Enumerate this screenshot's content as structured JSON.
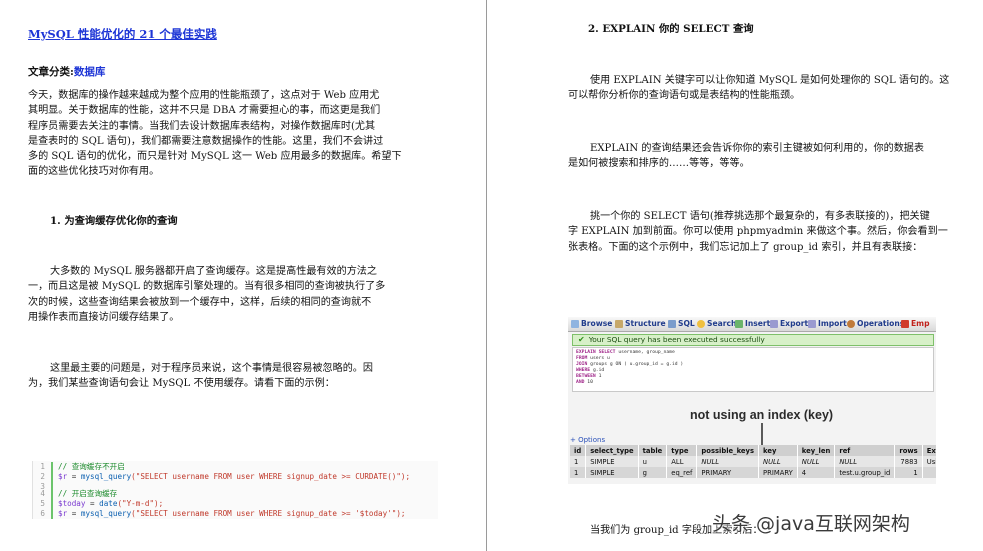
{
  "left": {
    "title": "MySQL 性能优化的 21 个最佳实践",
    "category_label": "文章分类:",
    "category_value": "数据库",
    "intro_lines": [
      "今天，数据库的操作越来越成为整个应用的性能瓶颈了，这点对于 Web 应用尤",
      "其明显。关于数据库的性能，这并不只是 DBA 才需要担心的事，而这更是我们",
      "程序员需要去关注的事情。当我们去设计数据库表结构，对操作数据库时(尤其",
      "是查表时的 SQL 语句)，我们都需要注意数据操作的性能。这里，我们不会讲过",
      "多的 SQL 语句的优化，而只是针对 MySQL 这一 Web 应用最多的数据库。希望下",
      "面的这些优化技巧对你有用。"
    ],
    "heading1": "1. 为查询缓存优化你的查询",
    "para2_lines": [
      "大多数的 MySQL 服务器都开启了查询缓存。这是提高性最有效的方法之",
      "一，而且这是被 MySQL 的数据库引擎处理的。当有很多相同的查询被执行了多",
      "次的时候，这些查询结果会被放到一个缓存中，这样，后续的相同的查询就不",
      "用操作表而直接访问缓存结果了。"
    ],
    "para3_lines": [
      "这里最主要的问题是，对于程序员来说，这个事情是很容易被忽略的。因",
      "为，我们某些查询语句会让 MySQL 不使用缓存。请看下面的示例："
    ],
    "code": {
      "line_numbers": [
        "1",
        "2",
        "3",
        "4",
        "5",
        "6"
      ],
      "l1": "// 查询缓存不开启",
      "l2_var": "$r",
      "l2_eq": " = ",
      "l2_fn": "mysql_query",
      "l2_str": "(\"SELECT username FROM user WHERE signup_date >= CURDATE()\");",
      "l4": "// 开启查询缓存",
      "l5_var": "$today",
      "l5_eq": " = ",
      "l5_fn": "date",
      "l5_str": "(\"Y-m-d\");",
      "l6_var": "$r",
      "l6_eq": " = ",
      "l6_fn": "mysql_query",
      "l6_str": "(\"SELECT username FROM user WHERE signup_date >= '$today'\");"
    }
  },
  "right": {
    "heading2": "2. EXPLAIN 你的 SELECT 查询",
    "p1_lines": [
      "使用 EXPLAIN 关键字可以让你知道 MySQL 是如何处理你的 SQL 语句的。这",
      "可以帮你分析你的查询语句或是表结构的性能瓶颈。"
    ],
    "p2_lines": [
      "EXPLAIN 的查询结果还会告诉你你的索引主键被如何利用的，你的数据表",
      "是如何被搜索和排序的……等等，等等。"
    ],
    "p3_lines": [
      "挑一个你的 SELECT 语句(推荐挑选那个最复杂的，有多表联接的)，把关键",
      "字 EXPLAIN 加到前面。你可以使用 phpmyadmin 来做这个事。然后，你会看到一",
      "张表格。下面的这个示例中，我们忘记加上了 group_id 索引，并且有表联接："
    ],
    "pma": {
      "tabs": [
        "Browse",
        "Structure",
        "SQL",
        "Search",
        "Insert",
        "Export",
        "Import",
        "Operations",
        "Emp"
      ],
      "success": "Your SQL query has been executed successfully",
      "sql_lines": [
        [
          "EXPLAIN SELECT",
          " username, group_name"
        ],
        [
          "FROM",
          " users u"
        ],
        [
          "JOIN",
          " groups g ON ( u.group_id = g.id )"
        ],
        [
          "WHERE",
          " g.id"
        ],
        [
          "BETWEEN",
          " 1"
        ],
        [
          "AND",
          " 10"
        ]
      ],
      "annotation": "not using an index (key)",
      "options": "+ Options",
      "headers": [
        "id",
        "select_type",
        "table",
        "type",
        "possible_keys",
        "key",
        "key_len",
        "ref",
        "rows",
        "Extra"
      ],
      "rows": [
        [
          "1",
          "SIMPLE",
          "u",
          "ALL",
          "NULL",
          "NULL",
          "NULL",
          "NULL",
          "7883",
          "Using where"
        ],
        [
          "1",
          "SIMPLE",
          "g",
          "eq_ref",
          "PRIMARY",
          "PRIMARY",
          "4",
          "test.u.group_id",
          "1",
          ""
        ]
      ]
    },
    "bottom_text": "当我们为 group_id 字段加上索引后："
  },
  "watermark": "头条 @java互联网架构"
}
